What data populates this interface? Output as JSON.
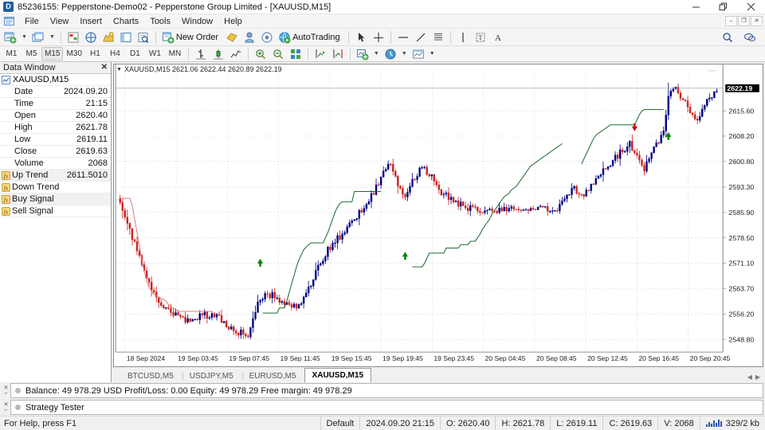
{
  "window": {
    "title": "85236155: Pepperstone-Demo02 - Pepperstone Group Limited - [XAUUSD,M15]",
    "app_icon": "metatrader-logo-icon",
    "minimize": "minimize-icon",
    "maximize": "restore-icon",
    "close": "close-icon"
  },
  "menu": {
    "items": [
      {
        "label": "File"
      },
      {
        "label": "View"
      },
      {
        "label": "Insert"
      },
      {
        "label": "Charts"
      },
      {
        "label": "Tools"
      },
      {
        "label": "Window"
      },
      {
        "label": "Help"
      }
    ],
    "mdi": [
      {
        "name": "mdi-minimize",
        "glyph": "–"
      },
      {
        "name": "mdi-restore",
        "glyph": "❐"
      },
      {
        "name": "mdi-close",
        "glyph": "✕"
      }
    ]
  },
  "toolbar": {
    "groups": [
      [
        {
          "name": "new-chart-button",
          "icon": "new-chart-icon",
          "dropdown": true
        },
        {
          "name": "profiles-button",
          "icon": "profiles-icon",
          "dropdown": true
        }
      ],
      [
        {
          "name": "market-watch-button",
          "icon": "market-watch-icon",
          "dropdown": false
        },
        {
          "name": "data-window-button",
          "icon": "data-window-icon",
          "dropdown": false
        },
        {
          "name": "navigator-button",
          "icon": "navigator-icon",
          "dropdown": false
        },
        {
          "name": "terminal-button",
          "icon": "terminal-icon",
          "dropdown": false
        },
        {
          "name": "strategy-tester-button",
          "icon": "strategy-tester-icon",
          "dropdown": false
        }
      ],
      [
        {
          "name": "new-order-button",
          "icon": "new-order-icon",
          "label": "New Order",
          "dropdown": false
        },
        {
          "name": "metaeditor-button",
          "icon": "metaeditor-icon",
          "dropdown": false
        },
        {
          "name": "expert-advisors-button",
          "icon": "expert-advisors-icon",
          "dropdown": false
        },
        {
          "name": "signals-button",
          "icon": "signals-icon",
          "dropdown": false
        },
        {
          "name": "autotrading-button",
          "icon": "autotrading-icon",
          "label": "AutoTrading",
          "dropdown": false
        }
      ],
      [
        {
          "name": "cursor-tool",
          "icon": "cursor-icon"
        },
        {
          "name": "crosshair-tool",
          "icon": "crosshair-icon"
        }
      ],
      [
        {
          "name": "horizontal-line-tool",
          "icon": "horizontal-line-icon"
        },
        {
          "name": "trendline-tool",
          "icon": "trendline-icon"
        },
        {
          "name": "fibonacci-tool",
          "icon": "fibonacci-icon"
        }
      ],
      [
        {
          "name": "vertical-line-tool",
          "icon": "vertical-line-icon"
        },
        {
          "name": "text-label-tool",
          "icon": "text-label-icon"
        },
        {
          "name": "text-tool",
          "icon": "text-a-icon"
        }
      ]
    ],
    "right": [
      {
        "name": "search-button",
        "icon": "search-icon"
      },
      {
        "name": "community-chat-button",
        "icon": "chat-icon"
      }
    ]
  },
  "periods": {
    "items": [
      {
        "label": "M1",
        "active": false
      },
      {
        "label": "M5",
        "active": false
      },
      {
        "label": "M15",
        "active": true
      },
      {
        "label": "M30",
        "active": false
      },
      {
        "label": "H1",
        "active": false
      },
      {
        "label": "H4",
        "active": false
      },
      {
        "label": "D1",
        "active": false
      },
      {
        "label": "W1",
        "active": false
      },
      {
        "label": "MN",
        "active": false
      }
    ],
    "chart_tools": [
      {
        "name": "bar-chart-button",
        "icon": "bar-chart-icon"
      },
      {
        "name": "candlestick-chart-button",
        "icon": "candlestick-icon"
      },
      {
        "name": "line-chart-button",
        "icon": "line-chart-icon"
      },
      {
        "name": "zoom-in-button",
        "icon": "zoom-in-icon"
      },
      {
        "name": "zoom-out-button",
        "icon": "zoom-out-icon"
      },
      {
        "name": "tile-windows-button",
        "icon": "tile-windows-icon"
      },
      {
        "name": "auto-scroll-button",
        "icon": "auto-scroll-icon"
      },
      {
        "name": "chart-shift-button",
        "icon": "chart-shift-icon"
      },
      {
        "name": "indicators-button",
        "icon": "indicators-icon",
        "dropdown": true
      },
      {
        "name": "periods-button",
        "icon": "clock-icon",
        "dropdown": true
      },
      {
        "name": "templates-button",
        "icon": "templates-icon",
        "dropdown": true
      }
    ]
  },
  "data_window": {
    "title": "Data Window",
    "close_icon": "close-icon",
    "symbol": "XAUUSD,M15",
    "symbol_icon": "chart-symbol-icon",
    "rows": [
      {
        "label": "Date",
        "value": "2024.09.20",
        "indicator": false
      },
      {
        "label": "Time",
        "value": "21:15",
        "indicator": false
      },
      {
        "label": "Open",
        "value": "2620.40",
        "indicator": false
      },
      {
        "label": "High",
        "value": "2621.78",
        "indicator": false
      },
      {
        "label": "Low",
        "value": "2619.11",
        "indicator": false
      },
      {
        "label": "Close",
        "value": "2619.63",
        "indicator": false
      },
      {
        "label": "Volume",
        "value": "2068",
        "indicator": false
      },
      {
        "label": "Up Trend",
        "value": "2611.5010",
        "indicator": true
      },
      {
        "label": "Down Trend",
        "value": "",
        "indicator": true
      },
      {
        "label": "Buy Signal",
        "value": "",
        "indicator": true
      },
      {
        "label": "Sell Signal",
        "value": "",
        "indicator": true
      }
    ]
  },
  "chart": {
    "header": "XAUUSD,M15  2621.06 2622.44 2620.89 2622.19",
    "dropdown_icon": "chevron-down-icon",
    "last_price_label": "2622.19",
    "colors": {
      "bull": "#000080",
      "bear": "#cc2222",
      "up_trend": "#1f6b2f",
      "down_trend": "#e08080",
      "grid": "#c8c8c8",
      "buy_arrow": "#008000",
      "sell_arrow": "#cc0000",
      "background": "#ffffff"
    }
  },
  "chart_data": {
    "type": "candlestick",
    "title": "XAUUSD,M15",
    "symbol": "XAUUSD",
    "timeframe": "M15",
    "xlabel": "",
    "ylabel": "",
    "grid": true,
    "ylim": [
      2545.1,
      2625.9
    ],
    "y_ticks": [
      "2615.60",
      "2608.20",
      "2600.80",
      "2593.30",
      "2585.90",
      "2578.50",
      "2571.10",
      "2563.70",
      "2556.20",
      "2548.80"
    ],
    "x_ticks": [
      "18 Sep 2024",
      "19 Sep 03:45",
      "19 Sep 07:45",
      "19 Sep 11:45",
      "19 Sep 15:45",
      "19 Sep 19:45",
      "19 Sep 23:45",
      "20 Sep 04:45",
      "20 Sep 08:45",
      "20 Sep 12:45",
      "20 Sep 16:45",
      "20 Sep 20:45"
    ],
    "quote_open": 2621.06,
    "quote_high": 2622.44,
    "quote_low": 2620.89,
    "quote_close": 2622.19,
    "last_price": 2622.19,
    "series": [
      {
        "name": "Up Trend",
        "type": "line",
        "color": "#1f6b2f",
        "values": [
          null,
          null,
          null,
          null,
          null,
          null,
          null,
          null,
          null,
          null,
          null,
          null,
          null,
          null,
          null,
          null,
          null,
          null,
          null,
          null,
          null,
          null,
          null,
          null,
          null,
          null,
          null,
          null,
          null,
          null,
          null,
          null,
          null,
          null,
          null,
          null,
          null,
          null,
          null,
          null,
          null,
          null,
          null,
          null,
          null,
          null,
          null,
          null,
          null,
          null,
          null,
          null,
          null,
          null,
          null,
          null,
          null,
          null,
          null,
          2556.5,
          2556.5,
          2556.5,
          2556.5,
          2556.5,
          2556.5,
          2556.5,
          2558.0,
          2558.0,
          2558.0,
          2560.0,
          2562.5,
          2565.0,
          2567.5,
          2570.0,
          2572.0,
          2573.5,
          2575.0,
          2575.8,
          2576.5,
          2577.0,
          2577.0,
          2577.0,
          2577.0,
          2577.0,
          2577.0,
          2578.5,
          2580.0,
          2582.0,
          2584.0,
          2586.0,
          2587.5,
          2588.5,
          2589.0,
          2589.0,
          2589.0,
          2589.0,
          2589.0,
          2592.0,
          2592.0,
          2592.0,
          2592.0,
          2592.0,
          2592.0,
          2592.0,
          2592.0,
          2592.0,
          2592.0,
          2592.0,
          2592.0,
          null,
          null,
          null,
          null,
          null,
          null,
          null,
          null,
          null,
          null,
          null,
          null,
          2570.0,
          2570.0,
          2570.0,
          2570.0,
          2570.0,
          2571.0,
          2572.5,
          2574.0,
          2574.0,
          2574.0,
          2574.0,
          2574.0,
          2574.0,
          2574.0,
          2575.5,
          2575.5,
          2575.5,
          2575.5,
          2575.5,
          2575.5,
          2576.5,
          2576.5,
          2576.5,
          2576.5,
          2577.5,
          2577.5,
          2577.5,
          2578.5,
          2579.5,
          2581.0,
          2582.0,
          2583.0,
          2584.0,
          2585.5,
          2586.5,
          2587.5,
          2588.5,
          2589.5,
          2590.5,
          2591.0,
          2591.5,
          2592.5,
          2593.0,
          2593.5,
          2594.5,
          2595.5,
          2596.5,
          2597.5,
          2598.5,
          2599.5,
          2600.0,
          2600.5,
          2601.0,
          2601.5,
          2602.0,
          2602.5,
          2603.0,
          2603.5,
          2604.0,
          2604.5,
          2605.0,
          2605.5,
          2606.0,
          null,
          null,
          null,
          null,
          null,
          null,
          null,
          2600.0,
          2601.5,
          2603.0,
          2604.5,
          2606.0,
          2607.5,
          2608.5,
          2609.0,
          2609.5,
          2610.0,
          2610.5,
          2611.0,
          2611.5,
          2611.5,
          2611.5,
          2611.5,
          2611.5,
          2611.5,
          2611.5,
          2611.5,
          2611.5,
          2611.5,
          2611.5,
          2613.0,
          2614.5,
          2615.5,
          2616.0,
          2616.0,
          2616.0,
          2616.0,
          2616.0,
          2616.0,
          2616.0,
          2616.0,
          2616.0
        ]
      },
      {
        "name": "Down Trend",
        "type": "line",
        "color": "#e08080",
        "values": [
          2590.0,
          2590.0,
          2590.0,
          2590.0,
          2590.0,
          2588.0,
          2584.0,
          2580.0,
          2576.0,
          2572.0,
          2568.5,
          2566.0,
          2564.0,
          2563.0,
          2562.0,
          2561.5,
          2561.0,
          2560.8,
          2560.5,
          2560.0,
          2559.0,
          2558.5,
          2558.0,
          2557.5,
          2557.0,
          2557.0,
          2557.0,
          2557.0,
          2557.0,
          2557.0,
          2557.0,
          2557.0,
          2557.0,
          2557.0,
          2557.0,
          2557.0,
          2557.0,
          2557.0,
          2557.0
        ]
      }
    ],
    "signals": [
      {
        "type": "buy",
        "label": "Buy Signal",
        "x_index": 58,
        "price": 2571.0
      },
      {
        "type": "buy",
        "label": "Buy Signal",
        "x_index": 118,
        "price": 2573.0
      },
      {
        "type": "sell",
        "label": "Sell Signal",
        "x_index": 213,
        "price": 2611.0
      },
      {
        "type": "buy",
        "label": "Buy Signal",
        "x_index": 227,
        "price": 2608.0
      }
    ]
  },
  "chart_tabs": {
    "items": [
      {
        "label": "BTCUSD,M5",
        "active": false
      },
      {
        "label": "USDJPY,M5",
        "active": false
      },
      {
        "label": "EURUSD,M5",
        "active": false
      },
      {
        "label": "XAUUSD,M15",
        "active": true
      }
    ],
    "scroll_left_icon": "chevron-left-icon",
    "scroll_right_icon": "chevron-right-icon"
  },
  "panels": [
    {
      "name": "terminal-panel",
      "close_icon": "close-icon",
      "pin_icon": "pin-icon",
      "text": "Balance: 49 978.29 USD  Profit/Loss: 0.00  Equity: 49 978.29  Free margin: 49 978.29"
    },
    {
      "name": "strategy-tester-panel",
      "close_icon": "close-icon",
      "pin_icon": "pin-icon",
      "text": "Strategy Tester"
    }
  ],
  "status_bar": {
    "help": "For Help, press F1",
    "profile": "Default",
    "datetime": "2024.09.20 21:15",
    "open": "O: 2620.40",
    "high": "H: 2621.78",
    "low": "L: 2619.11",
    "close": "C: 2619.63",
    "volume": "V: 2068",
    "traffic": "329/2 kb",
    "traffic_icon": "signal-bars-icon"
  }
}
